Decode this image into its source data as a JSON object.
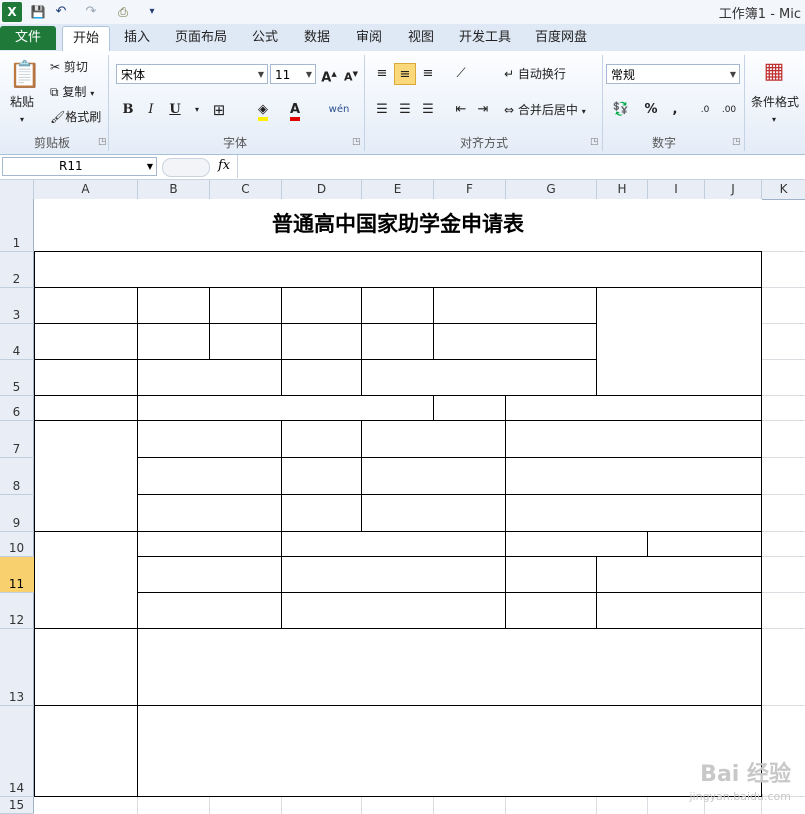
{
  "window": {
    "title": "工作簿1 - Mic"
  },
  "quick_access": [
    {
      "name": "excel-logo-icon",
      "glyph": "X"
    },
    {
      "name": "save-icon",
      "glyph": "💾"
    },
    {
      "name": "undo-icon",
      "glyph": "↶"
    },
    {
      "name": "redo-icon",
      "glyph": "↷"
    },
    {
      "name": "customize-icon",
      "glyph": "▾"
    }
  ],
  "tabs": [
    {
      "label": "文件"
    },
    {
      "label": "开始"
    },
    {
      "label": "插入"
    },
    {
      "label": "页面布局"
    },
    {
      "label": "公式"
    },
    {
      "label": "数据"
    },
    {
      "label": "审阅"
    },
    {
      "label": "视图"
    },
    {
      "label": "开发工具"
    },
    {
      "label": "百度网盘"
    }
  ],
  "ribbon": {
    "clipboard": {
      "paste": "粘贴",
      "cut": "剪切",
      "copy": "复制",
      "format_painter": "格式刷",
      "group": "剪贴板"
    },
    "font": {
      "name": "宋体",
      "size": "11",
      "group": "字体",
      "bold": "B",
      "italic": "I",
      "underline": "U"
    },
    "alignment": {
      "wrap": "自动换行",
      "merge": "合并后居中",
      "group": "对齐方式"
    },
    "number": {
      "format": "常规",
      "group": "数字",
      "percent": "%",
      "comma": ","
    },
    "styles": {
      "conditional": "条件格式"
    }
  },
  "formula_bar": {
    "name_box": "R11",
    "fx": "fx",
    "content": ""
  },
  "columns": [
    "A",
    "B",
    "C",
    "D",
    "E",
    "F",
    "G",
    "H",
    "I",
    "J",
    "K"
  ],
  "rows": [
    "1",
    "2",
    "3",
    "4",
    "5",
    "6",
    "7",
    "8",
    "9",
    "10",
    "11",
    "12",
    "13",
    "14",
    "15"
  ],
  "selected_row": "11",
  "sheet": {
    "title": "普通高中国家助学金申请表"
  },
  "watermark": {
    "text": "Bai 经验",
    "url": "jingyan.baidu.com"
  }
}
